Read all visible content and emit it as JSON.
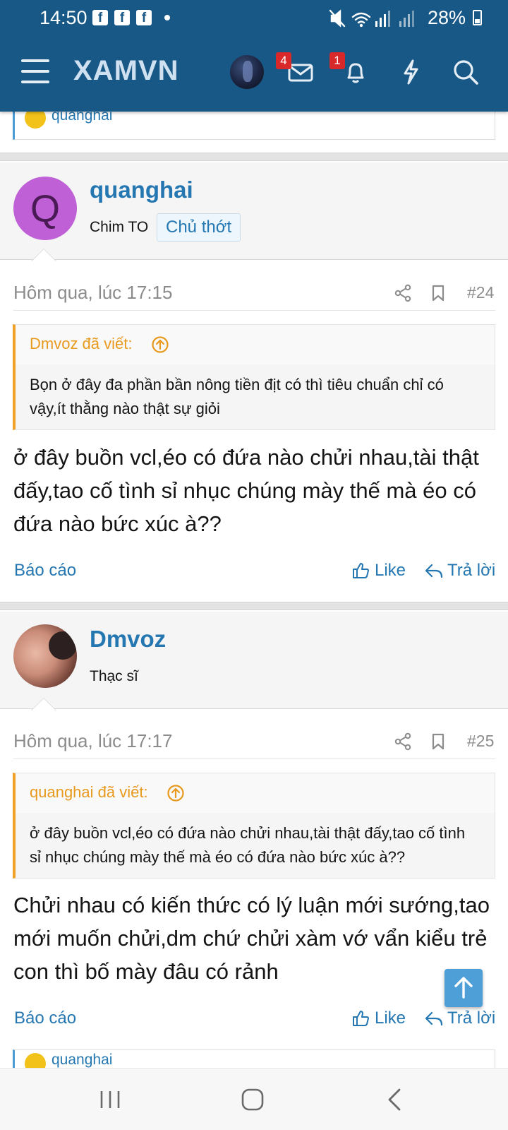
{
  "status_bar": {
    "time": "14:50",
    "fb_glyph": "f",
    "battery": "28%"
  },
  "header": {
    "logo": "XAMVN",
    "messages_badge": "4",
    "alerts_badge": "1"
  },
  "previous_post": {
    "reaction_user": "quanghai"
  },
  "posts": [
    {
      "username": "quanghai",
      "avatar_letter": "Q",
      "rank": "Chim TO",
      "role_badge": "Chủ thớt",
      "date": "Hôm qua, lúc 17:15",
      "number": "#24",
      "quote_author": "Dmvoz đã viết:",
      "quote_text": "Bọn ở đây đa phần bần nông tiền địt có thì tiêu chuẩn chỉ có vậy,ít thằng nào thật sự giỏi",
      "text": "ở đây buồn vcl,éo có đứa nào chửi nhau,tài thật đấy,tao cố tình sỉ nhục chúng mày thế mà éo có đứa nào bức xúc à??",
      "report": "Báo cáo",
      "like": "Like",
      "reply": "Trả lời"
    },
    {
      "username": "Dmvoz",
      "rank": "Thạc sĩ",
      "date": "Hôm qua, lúc 17:17",
      "number": "#25",
      "quote_author": "quanghai đã viết:",
      "quote_text": "ở đây buồn vcl,éo có đứa nào chửi nhau,tài thật đấy,tao cố tình sỉ nhục chúng mày thế mà éo có đứa nào bức xúc à??",
      "text": "Chửi nhau có kiến thức có lý luận mới sướng,tao mới muốn chửi,dm chứ chửi xàm vớ vẩn kiểu trẻ con thì bố mày đâu có rảnh",
      "report": "Báo cáo",
      "like": "Like",
      "reply": "Trả lời",
      "reaction_user": "quanghai"
    }
  ],
  "colors": {
    "header_bg": "#185886",
    "link": "#2577b1",
    "quote_accent": "#f0a024",
    "badge": "#d8282a"
  }
}
